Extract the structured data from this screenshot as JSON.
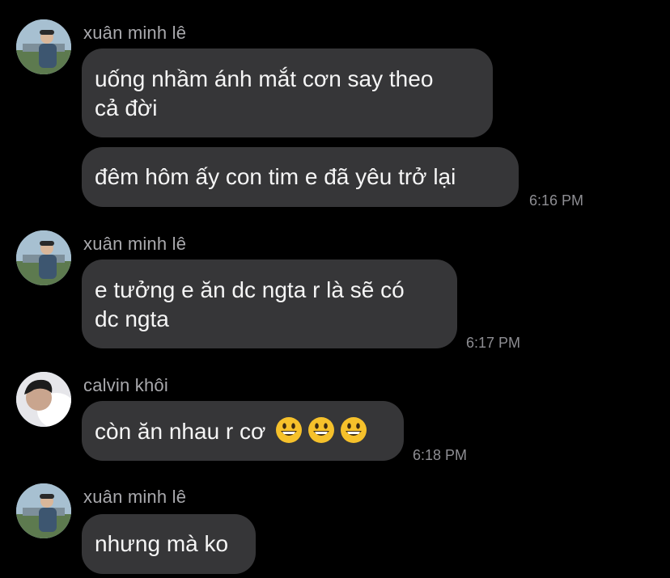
{
  "messages": [
    {
      "sender": "xuân minh lê",
      "avatar": "avatar-minh",
      "bubbles": [
        {
          "lines": [
            "uống nhầm ánh mắt cơn say theo",
            "cả đời"
          ]
        },
        {
          "lines": [
            "đêm hôm ấy con tim e đã yêu trở lại"
          ],
          "time": "6:16 PM"
        }
      ]
    },
    {
      "sender": "xuân minh lê",
      "avatar": "avatar-minh",
      "bubbles": [
        {
          "lines": [
            "e tưởng e ăn dc ngta r là sẽ có",
            "dc ngta"
          ],
          "time": "6:17 PM"
        }
      ]
    },
    {
      "sender": "calvin khôi",
      "avatar": "avatar-calvin",
      "bubbles": [
        {
          "lines": [
            "còn ăn nhau r cơ"
          ],
          "emojis": [
            "grinning-face-icon",
            "grinning-face-icon",
            "grinning-face-icon"
          ],
          "time": "6:18 PM"
        }
      ]
    },
    {
      "sender": "xuân minh lê",
      "avatar": "avatar-minh",
      "bubbles": [
        {
          "lines": [
            "nhưng mà ko"
          ]
        }
      ]
    }
  ],
  "colors": {
    "background": "#000000",
    "bubble": "#363638",
    "sender": "#a9a9ad",
    "timestamp": "#8e8e93",
    "emoji": "#f6c12b"
  }
}
